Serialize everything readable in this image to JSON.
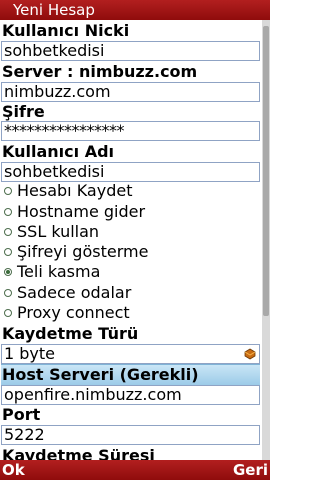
{
  "header": {
    "title": "Yeni Hesap"
  },
  "form": {
    "nick_label": "Kullanıcı Nicki",
    "nick_value": "sohbetkedisi",
    "server_label": "Server : nimbuzz.com",
    "server_value": "nimbuzz.com",
    "password_label": "Şifre",
    "password_value": "****************",
    "username_label": "Kullanıcı Adı",
    "username_value": "sohbetkedisi",
    "options": [
      {
        "label": "Hesabı Kaydet",
        "selected": false
      },
      {
        "label": "Hostname gider",
        "selected": false
      },
      {
        "label": "SSL kullan",
        "selected": false
      },
      {
        "label": "Şifreyi gösterme",
        "selected": false
      },
      {
        "label": "Teli kasma",
        "selected": true
      },
      {
        "label": "Sadece odalar",
        "selected": false
      },
      {
        "label": "Proxy connect",
        "selected": false
      }
    ],
    "save_type_label": "Kaydetme Türü",
    "save_type_value": "1 byte",
    "host_label": "Host Serveri (Gerekli)",
    "host_value": "openfire.nimbuzz.com",
    "port_label": "Port",
    "port_value": "5222",
    "save_duration_label": "Kaydetme Süresi"
  },
  "softkeys": {
    "left": "Ok",
    "right": "Geri"
  },
  "colors": {
    "bar": "#a01414",
    "highlight": "#b8def2",
    "field_border": "#8fa3c4"
  }
}
